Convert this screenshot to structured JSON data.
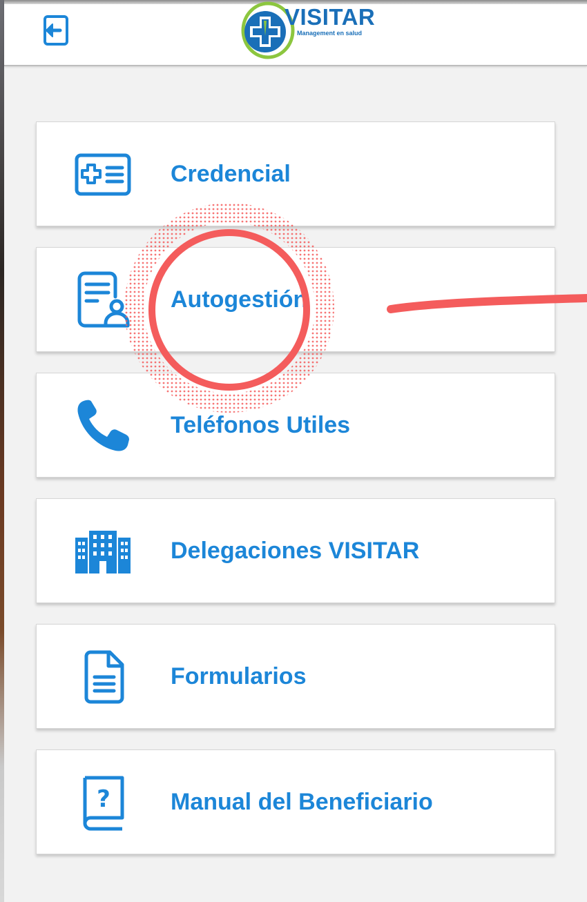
{
  "header": {
    "logo_text": "VISITAR",
    "logo_tagline": "Management en salud",
    "logout_icon": "logout-icon"
  },
  "menu": {
    "items": [
      {
        "label": "Credencial",
        "icon": "medical-card-icon"
      },
      {
        "label": "Autogestión",
        "icon": "document-user-icon"
      },
      {
        "label": "Teléfonos Utiles",
        "icon": "phone-icon"
      },
      {
        "label": "Delegaciones VISITAR",
        "icon": "building-icon"
      },
      {
        "label": "Formularios",
        "icon": "document-icon"
      },
      {
        "label": "Manual del Beneficiario",
        "icon": "help-book-icon"
      }
    ]
  },
  "colors": {
    "accent": "#1c86d8",
    "logo_blue": "#1a6fb8",
    "annotation_red": "#f45c5c",
    "background": "#f2f2f2"
  }
}
